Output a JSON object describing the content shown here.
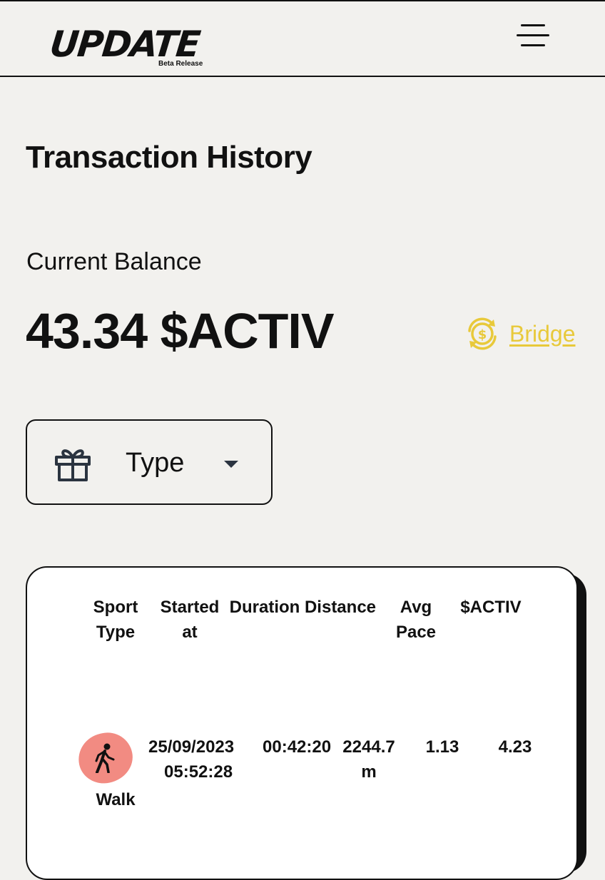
{
  "header": {
    "logo_text": "UPDATE",
    "logo_subtitle": "Beta Release",
    "menu_icon": "hamburger-menu-icon"
  },
  "page": {
    "title": "Transaction History"
  },
  "balance": {
    "label": "Current Balance",
    "value": "43.34 $ACTIV",
    "bridge_label": "Bridge",
    "bridge_icon": "dollar-exchange-icon",
    "bridge_color": "#e8c93a"
  },
  "filter": {
    "icon": "gift-icon",
    "label": "Type",
    "caret_icon": "caret-down-icon"
  },
  "table": {
    "columns": [
      [
        "Sport",
        "Type"
      ],
      [
        "Started",
        "at"
      ],
      [
        "Duration"
      ],
      [
        "Distance"
      ],
      [
        "Avg",
        "Pace"
      ],
      [
        "$ACTIV"
      ]
    ],
    "rows": [
      {
        "sport_icon": "walk-icon",
        "sport_badge_color": "#f28b82",
        "sport_type": "Walk",
        "started_at": [
          "25/09/2023",
          "05:52:28"
        ],
        "duration": "00:42:20",
        "distance": [
          "2244.7",
          "m"
        ],
        "avg_pace": "1.13",
        "activ": "4.23"
      }
    ]
  }
}
